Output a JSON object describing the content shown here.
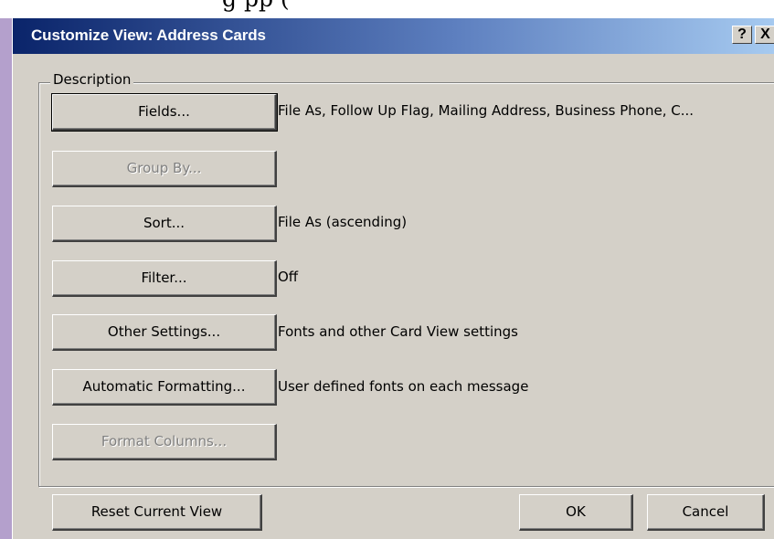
{
  "background_fragment": "g    pp    (",
  "title_bar": {
    "title": "Customize View: Address Cards",
    "help_label": "?",
    "close_label": "X"
  },
  "description_group": {
    "legend": "Description",
    "rows": [
      {
        "button_label": "Fields...",
        "description": "File As, Follow Up Flag, Mailing Address, Business Phone, C...",
        "enabled": true
      },
      {
        "button_label": "Group By...",
        "description": "",
        "enabled": false
      },
      {
        "button_label": "Sort...",
        "description": "File As (ascending)",
        "enabled": true
      },
      {
        "button_label": "Filter...",
        "description": "Off",
        "enabled": true
      },
      {
        "button_label": "Other Settings...",
        "description": "Fonts and other Card View settings",
        "enabled": true
      },
      {
        "button_label": "Automatic Formatting...",
        "description": "User defined fonts on each message",
        "enabled": true
      },
      {
        "button_label": "Format Columns...",
        "description": "",
        "enabled": false
      }
    ]
  },
  "footer": {
    "reset_label": "Reset Current View",
    "ok_label": "OK",
    "cancel_label": "Cancel"
  },
  "colors": {
    "title_bar_start": "#0a246a",
    "title_bar_end": "#a6caf0",
    "dialog_face": "#d4d0c8",
    "disabled_text": "#808080"
  }
}
